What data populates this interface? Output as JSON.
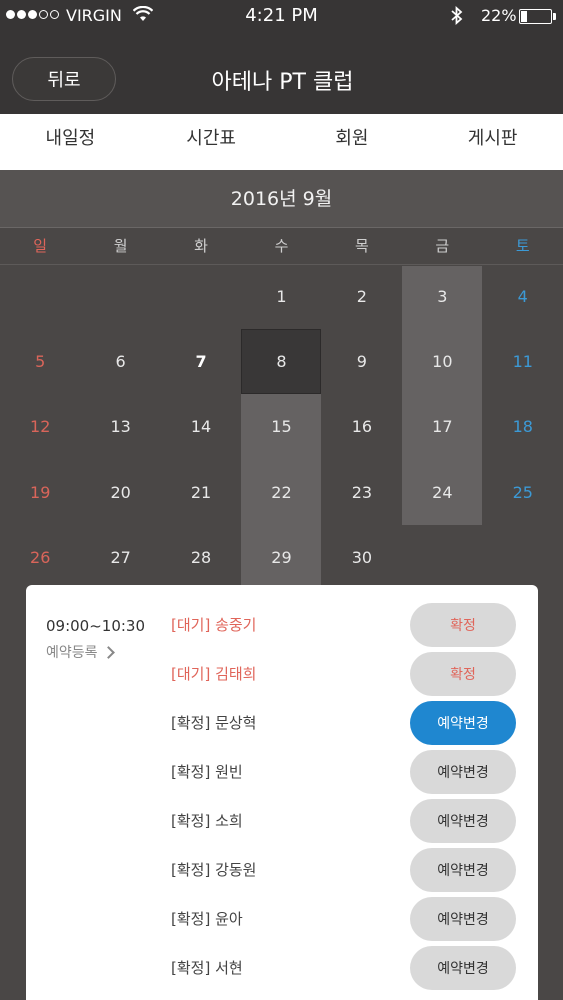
{
  "status_bar": {
    "carrier": "VIRGIN",
    "time": "4:21 PM",
    "battery": "22%",
    "battery_level": 0.22
  },
  "header": {
    "back_label": "뒤로",
    "title": "아테나 PT 클럽"
  },
  "tabs": [
    {
      "label": "내일정",
      "active": true
    },
    {
      "label": "시간표",
      "active": false
    },
    {
      "label": "회원",
      "active": false
    },
    {
      "label": "게시판",
      "active": false
    }
  ],
  "calendar": {
    "month_label": "2016년 9월",
    "weekdays": [
      "일",
      "월",
      "화",
      "수",
      "목",
      "금",
      "토"
    ],
    "days": [
      "",
      "",
      "",
      "1",
      "2",
      "3",
      "4",
      "5",
      "6",
      "7",
      "8",
      "9",
      "10",
      "11",
      "12",
      "13",
      "14",
      "15",
      "16",
      "17",
      "18",
      "19",
      "20",
      "21",
      "22",
      "23",
      "24",
      "25",
      "26",
      "27",
      "28",
      "29",
      "30",
      "",
      ""
    ],
    "selected_day": "8"
  },
  "reservation": {
    "time": "09:00~10:30",
    "register_label": "예약등록",
    "rows": [
      {
        "name": "[대기] 송중기",
        "action": "확정",
        "status": "wait"
      },
      {
        "name": "[대기] 김태희",
        "action": "확정",
        "status": "wait"
      },
      {
        "name": "[확정] 문상혁",
        "action": "예약변경",
        "status": "confirmed-selected"
      },
      {
        "name": "[확정] 원빈",
        "action": "예약변경",
        "status": "confirmed"
      },
      {
        "name": "[확정] 소희",
        "action": "예약변경",
        "status": "confirmed"
      },
      {
        "name": "[확정] 강동원",
        "action": "예약변경",
        "status": "confirmed"
      },
      {
        "name": "[확정] 윤아",
        "action": "예약변경",
        "status": "confirmed"
      },
      {
        "name": "[확정] 서현",
        "action": "예약변경",
        "status": "confirmed"
      }
    ]
  }
}
